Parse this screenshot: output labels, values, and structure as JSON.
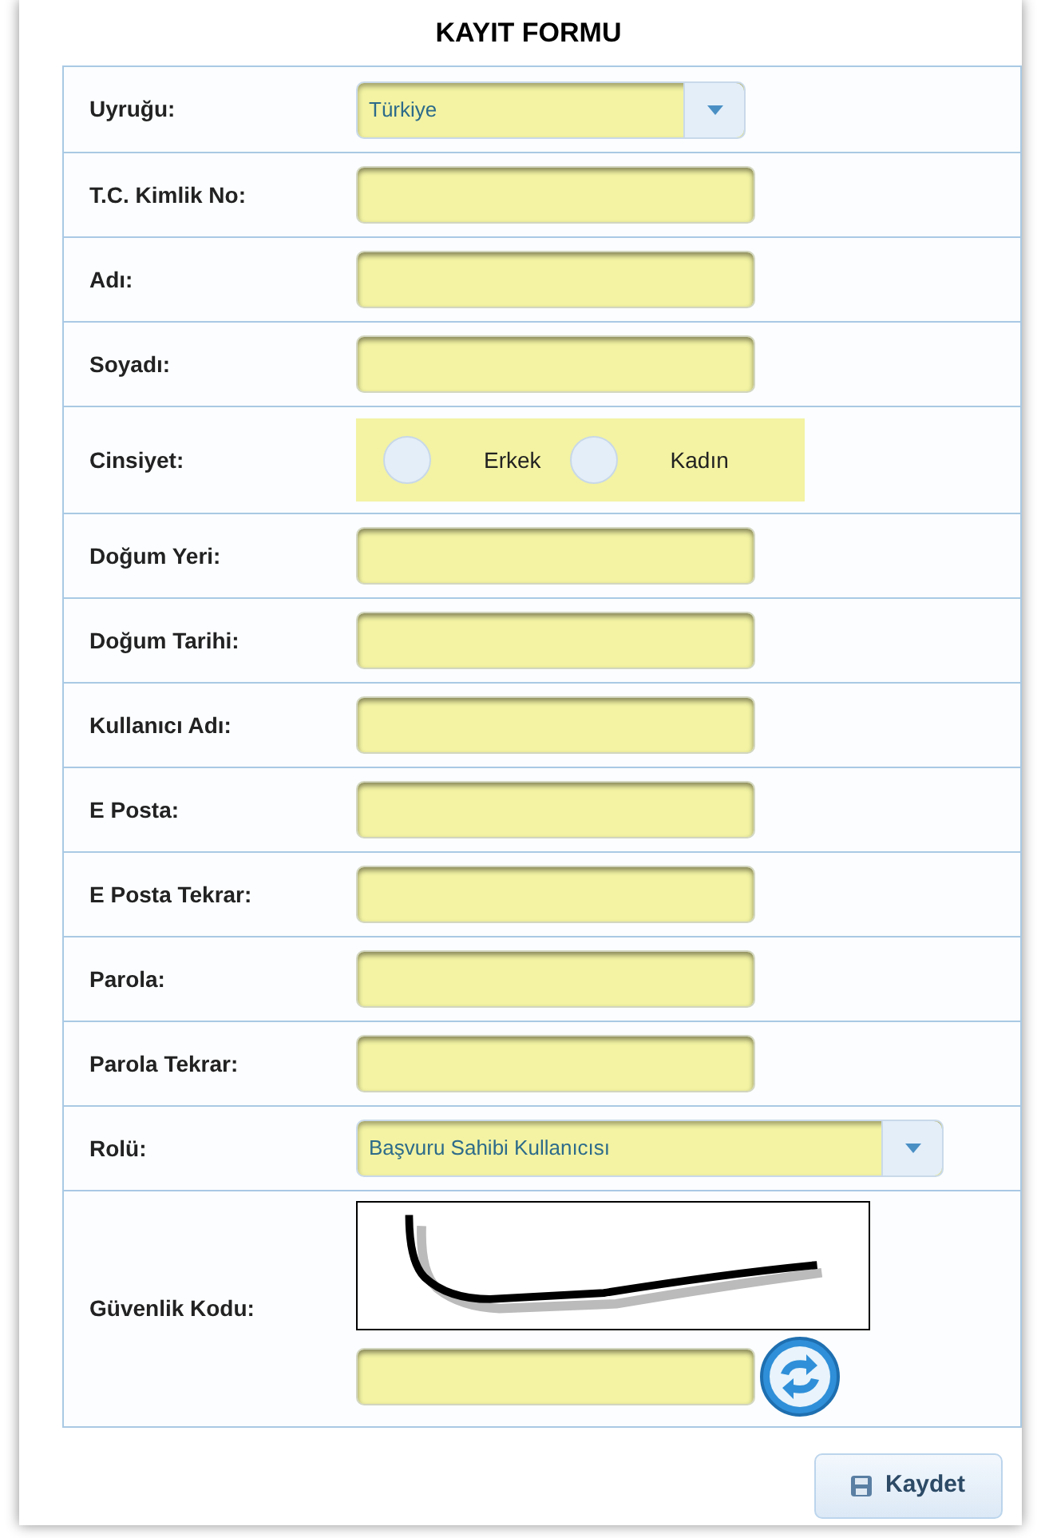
{
  "title": "KAYIT FORMU",
  "fields": [
    {
      "kind": "select",
      "label": "Uyruğu:",
      "value": "Türkiye",
      "wide": false
    },
    {
      "kind": "text",
      "label": "T.C. Kimlik No:"
    },
    {
      "kind": "text",
      "label": "Adı:"
    },
    {
      "kind": "text",
      "label": "Soyadı:"
    },
    {
      "kind": "radio",
      "label": "Cinsiyet:",
      "options": [
        {
          "label": "Erkek",
          "selected": false
        },
        {
          "label": "Kadın",
          "selected": false
        }
      ]
    },
    {
      "kind": "text",
      "label": "Doğum Yeri:"
    },
    {
      "kind": "text",
      "label": "Doğum Tarihi:"
    },
    {
      "kind": "text",
      "label": "Kullanıcı Adı:"
    },
    {
      "kind": "text",
      "label": "E Posta:"
    },
    {
      "kind": "text",
      "label": "E Posta Tekrar:"
    },
    {
      "kind": "text",
      "label": "Parola:"
    },
    {
      "kind": "text",
      "label": "Parola Tekrar:"
    },
    {
      "kind": "select",
      "label": "Rolü:",
      "value": "Başvuru Sahibi Kullanıcısı",
      "wide": true
    },
    {
      "kind": "captcha",
      "label": "Güvenlik Kodu:"
    }
  ],
  "save_button": "Kaydet"
}
